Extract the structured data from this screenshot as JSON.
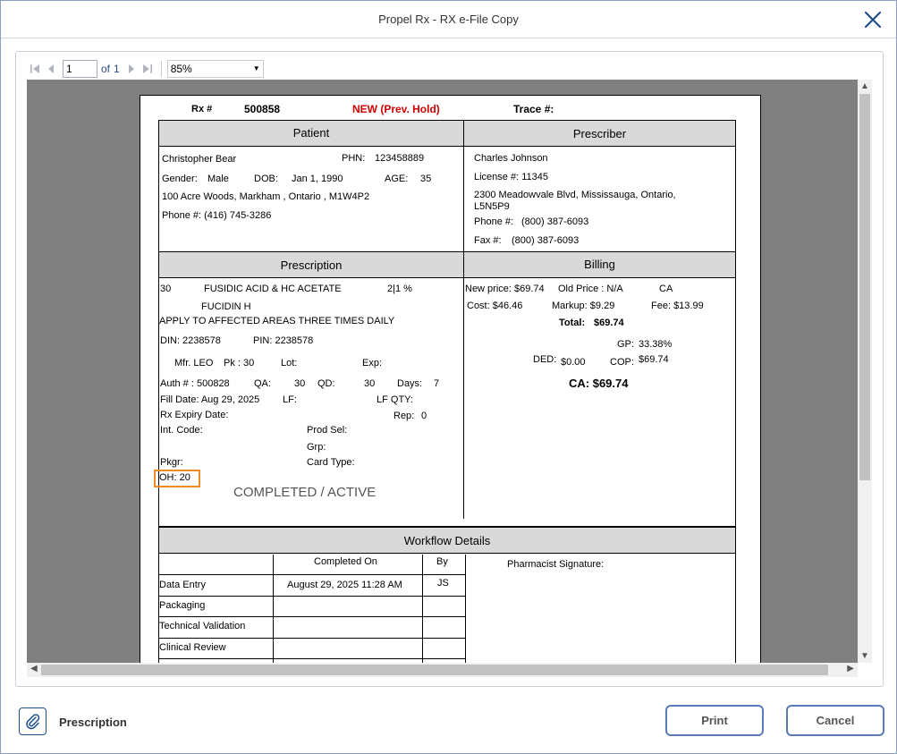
{
  "window": {
    "title": "Propel Rx - RX e-File Copy"
  },
  "toolbar": {
    "page_value": "1",
    "of_label": "of",
    "total_pages": "1",
    "zoom": "85%"
  },
  "report": {
    "rx_label": "Rx #",
    "rx_number": "500858",
    "status_flag": "NEW (Prev. Hold)",
    "trace_label": "Trace #:",
    "patient": {
      "heading": "Patient",
      "name": "Christopher Bear",
      "phn_label": "PHN:",
      "phn": "123458889",
      "gender_label": "Gender:",
      "gender": "Male",
      "dob_label": "DOB:",
      "dob": "Jan 1, 1990",
      "age_label": "AGE:",
      "age": "35",
      "address": "100 Acre Woods, Markham , Ontario , M1W4P2",
      "phone": "Phone #: (416) 745-3286"
    },
    "prescriber": {
      "heading": "Prescriber",
      "name": "Charles Johnson",
      "license": "License #: 11345",
      "address_line1": "2300 Meadowvale Blvd, Mississauga, Ontario,",
      "address_line2": "L5N5P9",
      "phone_label": "Phone #:",
      "phone": "(800) 387-6093",
      "fax_label": "Fax #:",
      "fax": "(800) 387-6093"
    },
    "prescription": {
      "heading": "Prescription",
      "qty": "30",
      "drug": "FUSIDIC ACID & HC ACETATE",
      "strength": "2|1 %",
      "brand": "FUCIDIN H",
      "sig": "APPLY TO AFFECTED AREAS THREE TIMES DAILY",
      "din": "DIN:  2238578",
      "pin": "PIN: 2238578",
      "mfr": "Mfr. LEO",
      "pk": "Pk :  30",
      "lot": "Lot:",
      "exp": "Exp:",
      "auth": "Auth # :   500828",
      "qa": "QA:",
      "qa_val": "30",
      "qd": "QD:",
      "qd_val": "30",
      "days": "Days:",
      "days_val": "7",
      "fill_date": "Fill Date:   Aug 29, 2025",
      "lf": "LF:",
      "lf_qty": "LF QTY:",
      "rx_expiry": "Rx Expiry Date:",
      "rep": "Rep:",
      "rep_val": "0",
      "int_code": "Int. Code:",
      "prod_sel": "Prod Sel:",
      "grp": "Grp:",
      "pkgr": "Pkgr:",
      "card_type": "Card Type:",
      "oh": "OH: 20",
      "status": "COMPLETED / ACTIVE"
    },
    "billing": {
      "heading": "Billing",
      "new_price": "New price:  $69.74",
      "old_price": "Old Price : N/A",
      "plan": "CA",
      "cost": "Cost: $46.46",
      "markup": "Markup:  $9.29",
      "fee": "Fee:  $13.99",
      "total_label": "Total:",
      "total": "$69.74",
      "gp_label": "GP:",
      "gp": "33.38%",
      "ded_label": "DED:",
      "ded": "$0.00",
      "cop_label": "COP:",
      "cop": "$69.74",
      "ca_total": "CA: $69.74"
    },
    "workflow": {
      "heading": "Workflow Details",
      "col_completed": "Completed On",
      "col_by": "By",
      "signature_label": "Pharmacist Signature:",
      "rows": [
        {
          "step": "Data Entry",
          "completed": "August 29, 2025 11:28 AM",
          "by": "JS"
        },
        {
          "step": "Packaging",
          "completed": "",
          "by": ""
        },
        {
          "step": "Technical Validation",
          "completed": "",
          "by": ""
        },
        {
          "step": "Clinical Review",
          "completed": "",
          "by": ""
        }
      ]
    }
  },
  "bottom": {
    "attachment_label": "Prescription",
    "print_label": "Print",
    "cancel_label": "Cancel"
  },
  "colors": {
    "accent": "#1f4e8c",
    "highlight": "#f08a24",
    "status_red": "#d00000"
  }
}
